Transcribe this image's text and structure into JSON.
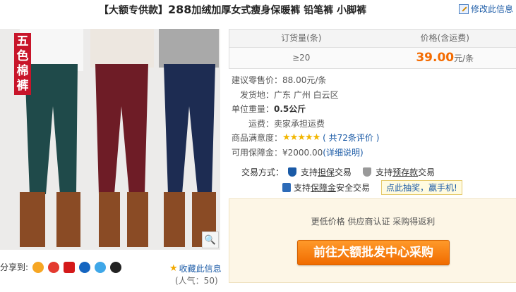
{
  "header": {
    "title_prefix": "【大额专供款】",
    "title_num": "288",
    "title_rest": "加绒加厚女式瘦身保暖裤 铅笔裤 小脚裤",
    "edit_link": "修改此信息"
  },
  "image": {
    "overlay_text": "五色棉裤",
    "pants_colors": [
      "#1f4a4a",
      "#6e1c26",
      "#1d2c52"
    ],
    "boot_color": "#8a4b25"
  },
  "share": {
    "label": "分享到:",
    "favorite": "收藏此信息",
    "popularity": "(人气：50)"
  },
  "price_table": {
    "col_qty": "订货量(条)",
    "col_price": "价格(含运费)",
    "qty": "≥20",
    "price": "39.00",
    "unit": "元/条"
  },
  "info": {
    "retail_label": "建议零售价：",
    "retail_value": "88.00元/条",
    "ship_from_label": "发货地：",
    "ship_from_value": "广东 广州 白云区",
    "weight_label": "单位重量：",
    "weight_value": "0.5公斤",
    "freight_label": "运费：",
    "freight_value": "卖家承担运费",
    "rating_label": "商品满意度：",
    "rating_stars": "★★★★★",
    "rating_count": "( 共72条评价 )",
    "deposit_label": "可用保障金：",
    "deposit_value": "¥2000.00",
    "deposit_link": "(详细说明)"
  },
  "trade": {
    "label": "交易方式：",
    "opt1_pre": "支持",
    "opt1_link": "担保",
    "opt1_post": "交易",
    "opt2_pre": "支持",
    "opt2_link": "预存款",
    "opt2_post": "交易",
    "opt3_pre": "支持",
    "opt3_link": "保障金",
    "opt3_post": "安全交易",
    "tooltip": "点此抽奖，赢手机!"
  },
  "cta": {
    "benefits": "更低价格 供应商认证 采购得返利",
    "button": "前往大额批发中心采购"
  }
}
